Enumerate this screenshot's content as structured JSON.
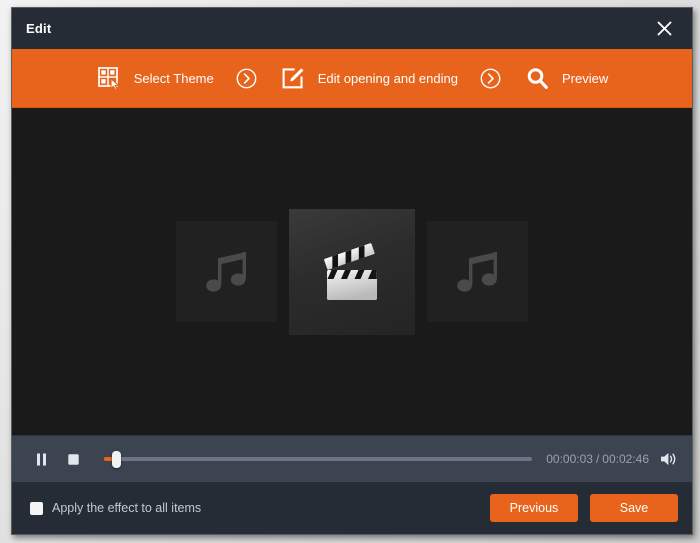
{
  "window": {
    "title": "Edit",
    "close_icon": "close-icon"
  },
  "toolbar": {
    "accent_color": "#e8641c",
    "steps": [
      {
        "label": "Select Theme",
        "icon": "theme-grid-cursor-icon"
      },
      {
        "label": "Edit opening and ending",
        "icon": "edit-pencil-square-icon"
      },
      {
        "label": "Preview",
        "icon": "magnifier-icon"
      }
    ],
    "separator_icon": "chevron-right-circle-icon"
  },
  "preview": {
    "background_color": "#1a1a1a",
    "thumbnails": [
      {
        "icon": "music-note-icon",
        "state": "inactive"
      },
      {
        "icon": "clapperboard-icon",
        "state": "active"
      },
      {
        "icon": "music-note-icon",
        "state": "inactive"
      }
    ]
  },
  "transport": {
    "pause_icon": "pause-icon",
    "stop_icon": "stop-icon",
    "volume_icon": "speaker-volume-icon",
    "seek_percent": 2,
    "current_time": "00:00:03",
    "time_separator": "/",
    "total_time": "00:02:46"
  },
  "footer": {
    "apply_all_label": "Apply the effect to all items",
    "apply_all_checked": false,
    "previous_label": "Previous",
    "save_label": "Save"
  }
}
